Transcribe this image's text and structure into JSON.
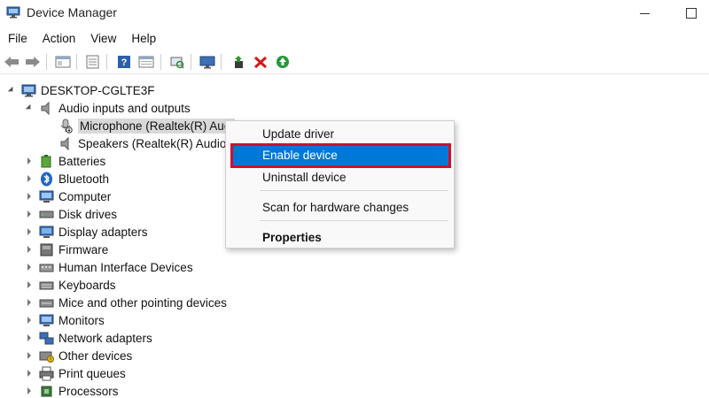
{
  "window": {
    "title": "Device Manager",
    "icon": "device-manager-icon"
  },
  "menu": [
    "File",
    "Action",
    "View",
    "Help"
  ],
  "toolbar": {
    "buttons": [
      "back-icon",
      "forward-icon",
      "show-hide-tree-icon",
      "properties-icon",
      "help-icon",
      "view-icon",
      "scan-hardware-icon",
      "monitor-icon",
      "update-driver-icon",
      "uninstall-icon",
      "enable-device-icon"
    ]
  },
  "tree": {
    "root": "DESKTOP-CGLTE3F",
    "audio": {
      "label": "Audio inputs and outputs",
      "children": [
        "Microphone (Realtek(R) Audio)",
        "Speakers (Realtek(R) Audio)"
      ],
      "visible_child_0": "Microphone (Realtek(R) Audi"
    },
    "categories": [
      "Batteries",
      "Bluetooth",
      "Computer",
      "Disk drives",
      "Display adapters",
      "Firmware",
      "Human Interface Devices",
      "Keyboards",
      "Mice and other pointing devices",
      "Monitors",
      "Network adapters",
      "Other devices",
      "Print queues",
      "Processors"
    ]
  },
  "context_menu": {
    "items": [
      "Update driver",
      "Enable device",
      "Uninstall device",
      "Scan for hardware changes",
      "Properties"
    ],
    "highlighted": "Enable device",
    "highlight_color": "#0078d7",
    "annotation_color": "#d20f2a"
  }
}
